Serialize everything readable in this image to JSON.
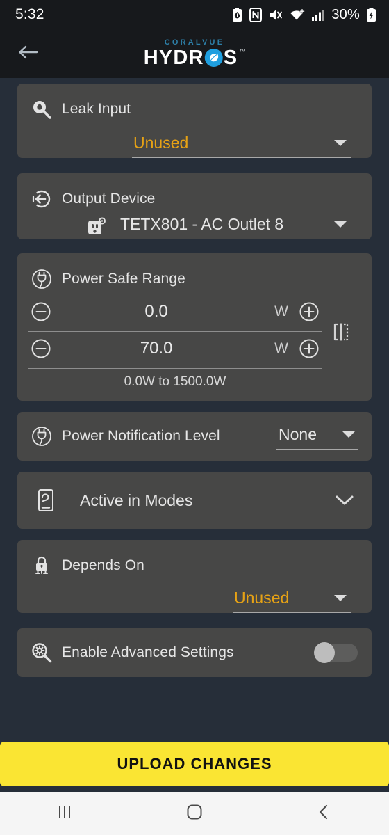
{
  "status_bar": {
    "time": "5:32",
    "battery_percent": "30%",
    "icons": [
      "battery-saver-icon",
      "nfc-icon",
      "mute-icon",
      "wifi-icon",
      "cellular-signal-icon",
      "charging-battery-icon"
    ]
  },
  "app_bar": {
    "back_icon": "back-arrow-icon",
    "brand_top": "CORALVUE",
    "brand_main_left": "HYDR",
    "brand_main_right": "S",
    "brand_emblem": "leaf-emblem-icon",
    "trademark": "™",
    "emblem_color": "#1f9fe0",
    "brand_top_color": "#2d7fa8"
  },
  "colors": {
    "page_background": "#262e39",
    "card_background": "#474746",
    "accent_orange": "#e6a215",
    "upload_yellow": "#fae533"
  },
  "cards": {
    "leak_input": {
      "icon": "water-drop-magnifier-icon",
      "title": "Leak Input",
      "value": "Unused"
    },
    "output_device": {
      "icon": "output-arrow-icon",
      "title": "Output Device",
      "value_icon": "ac-outlet-icon",
      "value": "TETX801 - AC Outlet 8"
    },
    "power_safe_range": {
      "icon": "power-plug-icon",
      "title": "Power Safe Range",
      "min_value": "0.0",
      "min_unit": "W",
      "max_value": "70.0",
      "max_unit": "W",
      "hint": "0.0W to 1500.0W",
      "side_icon": "range-bracket-icon",
      "minus_icon": "minus-circle-icon",
      "plus_icon": "plus-circle-icon"
    },
    "power_notification_level": {
      "icon": "power-plug-icon",
      "title": "Power Notification Level",
      "value": "None"
    },
    "active_in_modes": {
      "icon": "device-mode-icon",
      "title": "Active in Modes",
      "chevron": "chevron-down-icon"
    },
    "depends_on": {
      "icon": "lock-dependency-icon",
      "title": "Depends On",
      "value": "Unused"
    },
    "enable_advanced_settings": {
      "icon": "gear-magnifier-icon",
      "title": "Enable Advanced Settings",
      "toggle_state": "off"
    }
  },
  "footer": {
    "upload_label": "UPLOAD CHANGES"
  },
  "nav_bar": {
    "recents_icon": "recents-icon",
    "home_icon": "home-icon",
    "back_icon": "nav-back-icon"
  }
}
